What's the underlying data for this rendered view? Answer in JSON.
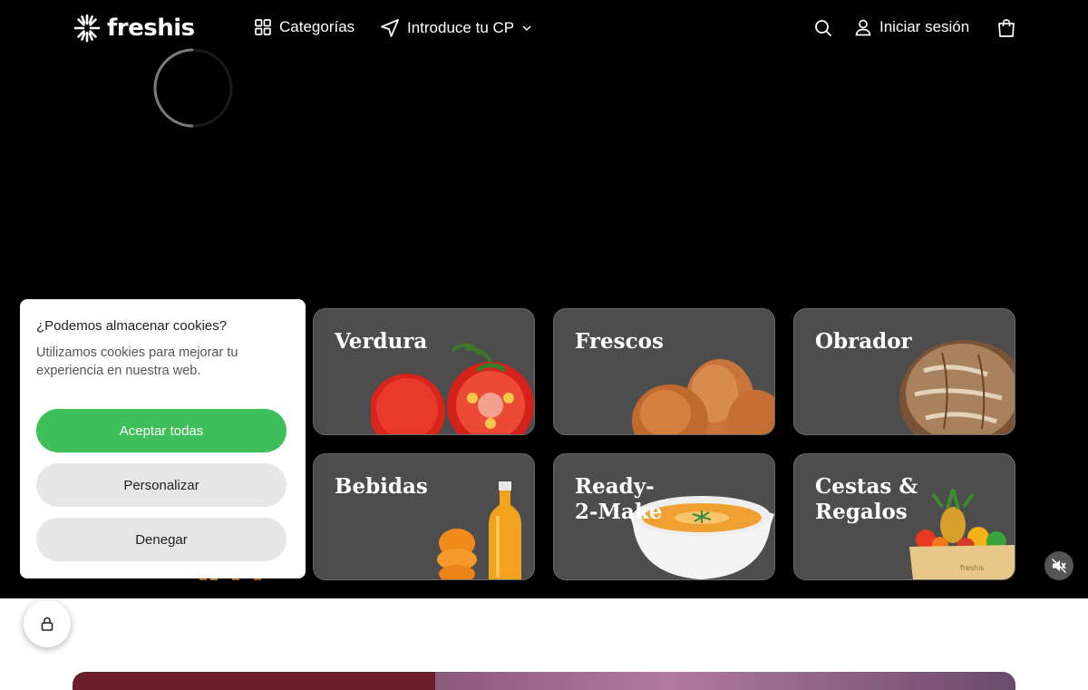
{
  "header": {
    "logo_text": "freshis",
    "categories_label": "Categorías",
    "postcode_label": "Introduce tu CP",
    "login_label": "Iniciar sesión"
  },
  "categories": [
    {
      "label": "Verdura"
    },
    {
      "label": "Frescos"
    },
    {
      "label": "Obrador"
    },
    {
      "label": "Bebidas"
    },
    {
      "label": "Ready-\n2-Make"
    },
    {
      "label": "Cestas &\nRegalos"
    }
  ],
  "cookie_banner": {
    "title": "¿Podemos almacenar cookies?",
    "text": "Utilizamos cookies para mejorar tu experiencia en nuestra web.",
    "accept_label": "Aceptar todas",
    "customize_label": "Personalizar",
    "deny_label": "Denegar"
  },
  "colors": {
    "accent_green": "#3fbf5a",
    "hero_bg": "#000000",
    "card_bg": "#4d4d4d"
  },
  "icons": {
    "categories": "grid-icon",
    "postcode": "navigation-arrow-icon",
    "search": "search-icon",
    "login": "user-icon",
    "cart": "shopping-bag-icon",
    "mute": "mute-icon",
    "privacy": "lock-icon"
  }
}
